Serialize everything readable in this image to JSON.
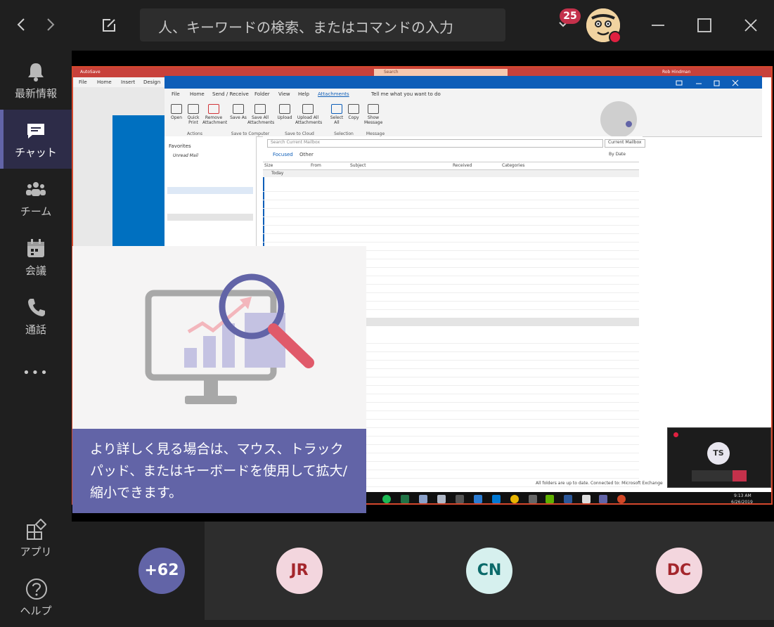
{
  "search": {
    "placeholder": "人、キーワードの検索、またはコマンドの入力"
  },
  "notifications": {
    "count": "25"
  },
  "rail": {
    "items": [
      {
        "label": "最新情報"
      },
      {
        "label": "チャット"
      },
      {
        "label": "チーム"
      },
      {
        "label": "会議"
      },
      {
        "label": "通話"
      },
      {
        "label": "•••"
      },
      {
        "label": "アプリ"
      },
      {
        "label": "ヘルプ"
      }
    ]
  },
  "shared_screen": {
    "word_menu": [
      "File",
      "Home",
      "Insert",
      "Design"
    ],
    "word_autosave": "AutoSave",
    "word_search": "Search",
    "word_user": "Rob Hindman",
    "outlook_tabs": [
      "File",
      "Home",
      "Send / Receive",
      "Folder",
      "View",
      "Help",
      "Attachments"
    ],
    "outlook_tell": "Tell me what you want to do",
    "ribbon_buttons": [
      "Open",
      "Quick Print",
      "Remove Attachment",
      "Save As",
      "Save All Attachments",
      "Upload",
      "Upload All Attachments",
      "Select All",
      "Copy",
      "Show Message"
    ],
    "ribbon_groups": [
      "Actions",
      "Save to Computer",
      "Save to Cloud",
      "Selection",
      "Message"
    ],
    "favorites": "Favorites",
    "unread_mail": "Unread Mail",
    "search_mailbox": "Search Current Mailbox",
    "current_mailbox": "Current Mailbox",
    "focused": "Focused",
    "other": "Other",
    "by_date": "By Date",
    "columns": [
      "Size",
      "From",
      "Subject",
      "Received",
      "Categories"
    ],
    "group_today": "Today",
    "status_left": "All folders are up to date.",
    "status_right": "Connected to: Microsoft Exchange",
    "clock_time": "9:13 AM",
    "clock_date": "6/26/2019"
  },
  "mini_call": {
    "initials": "TS"
  },
  "tip": {
    "text": "より詳しく見る場合は、マウス、トラックパッド、またはキーボードを使用して拡大/縮小できます。"
  },
  "participants": [
    {
      "label": "+62",
      "bg": "#6264a7",
      "fg": "#ffffff"
    },
    {
      "label": "JR",
      "bg": "#f3d6de",
      "fg": "#a4262c"
    },
    {
      "label": "CN",
      "bg": "#d6f0ee",
      "fg": "#0b6a6a"
    },
    {
      "label": "DC",
      "bg": "#f3d6de",
      "fg": "#a4262c"
    }
  ]
}
